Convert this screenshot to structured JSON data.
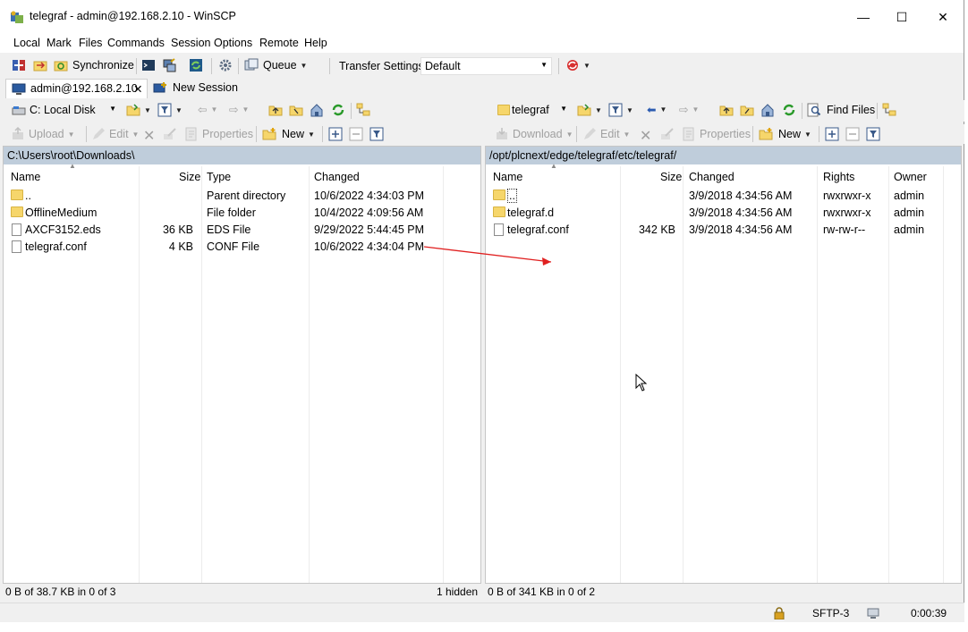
{
  "window": {
    "title": "telegraf - admin@192.168.2.10 - WinSCP",
    "minimize": "—",
    "maximize": "☐",
    "close": "✕"
  },
  "menu": [
    "Local",
    "Mark",
    "Files",
    "Commands",
    "Session",
    "Options",
    "Remote",
    "Help"
  ],
  "toolbar1": {
    "synchronize": "Synchronize",
    "queue": "Queue",
    "transfer_settings_label": "Transfer Settings",
    "transfer_settings_value": "Default"
  },
  "tabs": {
    "session": "admin@192.168.2.10",
    "session_close": "✕",
    "new_session": "New Session"
  },
  "left": {
    "drive": "C: Local Disk",
    "upload": "Upload",
    "edit": "Edit",
    "properties": "Properties",
    "new": "New",
    "path": "C:\\Users\\root\\Downloads\\",
    "columns": {
      "name": "Name",
      "size": "Size",
      "type": "Type",
      "changed": "Changed"
    },
    "rows": [
      {
        "name": "..",
        "size": "",
        "type": "Parent directory",
        "changed": "10/6/2022  4:34:03 PM",
        "icon": "parent-folder"
      },
      {
        "name": "OfflineMedium",
        "size": "",
        "type": "File folder",
        "changed": "10/4/2022  4:09:56 AM",
        "icon": "folder"
      },
      {
        "name": "AXCF3152.eds",
        "size": "36 KB",
        "type": "EDS File",
        "changed": "9/29/2022  5:44:45 PM",
        "icon": "file"
      },
      {
        "name": "telegraf.conf",
        "size": "4 KB",
        "type": "CONF File",
        "changed": "10/6/2022  4:34:04 PM",
        "icon": "file"
      }
    ],
    "status": "0 B of 38.7 KB in 0 of 3",
    "hidden": "1 hidden"
  },
  "right": {
    "folder": "telegraf",
    "find_files": "Find Files",
    "download": "Download",
    "edit": "Edit",
    "properties": "Properties",
    "new": "New",
    "path": "/opt/plcnext/edge/telegraf/etc/telegraf/",
    "columns": {
      "name": "Name",
      "size": "Size",
      "changed": "Changed",
      "rights": "Rights",
      "owner": "Owner"
    },
    "rows": [
      {
        "name": "..",
        "size": "",
        "changed": "3/9/2018 4:34:56 AM",
        "rights": "rwxrwxr-x",
        "owner": "admin",
        "icon": "parent-folder"
      },
      {
        "name": "telegraf.d",
        "size": "",
        "changed": "3/9/2018 4:34:56 AM",
        "rights": "rwxrwxr-x",
        "owner": "admin",
        "icon": "folder"
      },
      {
        "name": "telegraf.conf",
        "size": "342 KB",
        "changed": "3/9/2018 4:34:56 AM",
        "rights": "rw-rw-r--",
        "owner": "admin",
        "icon": "file"
      }
    ],
    "status": "0 B of 341 KB in 0 of 2"
  },
  "bottom": {
    "protocol": "SFTP-3",
    "time": "0:00:39"
  },
  "colors": {
    "path_bar": "#bfcddb",
    "arrow": "#e02020",
    "folder": "#f6d66b"
  }
}
